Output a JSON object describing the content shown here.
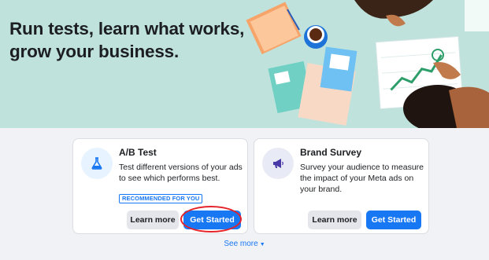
{
  "hero": {
    "title": "Run tests, learn what works, grow your business."
  },
  "cards": [
    {
      "title": "A/B Test",
      "description": "Test different versions of your ads to see which performs best.",
      "badge": "RECOMMENDED FOR YOU",
      "icon": "flask-icon",
      "learn_more": "Learn more",
      "get_started": "Get Started"
    },
    {
      "title": "Brand Survey",
      "description": "Survey your audience to measure the impact of your Meta ads on your brand.",
      "icon": "megaphone-icon",
      "learn_more": "Learn more",
      "get_started": "Get Started"
    }
  ],
  "see_more": "See more",
  "colors": {
    "hero_bg": "#bfe3dc",
    "primary": "#1877f2",
    "highlight": "#e4232a",
    "page_bg": "#f0f2f5"
  }
}
